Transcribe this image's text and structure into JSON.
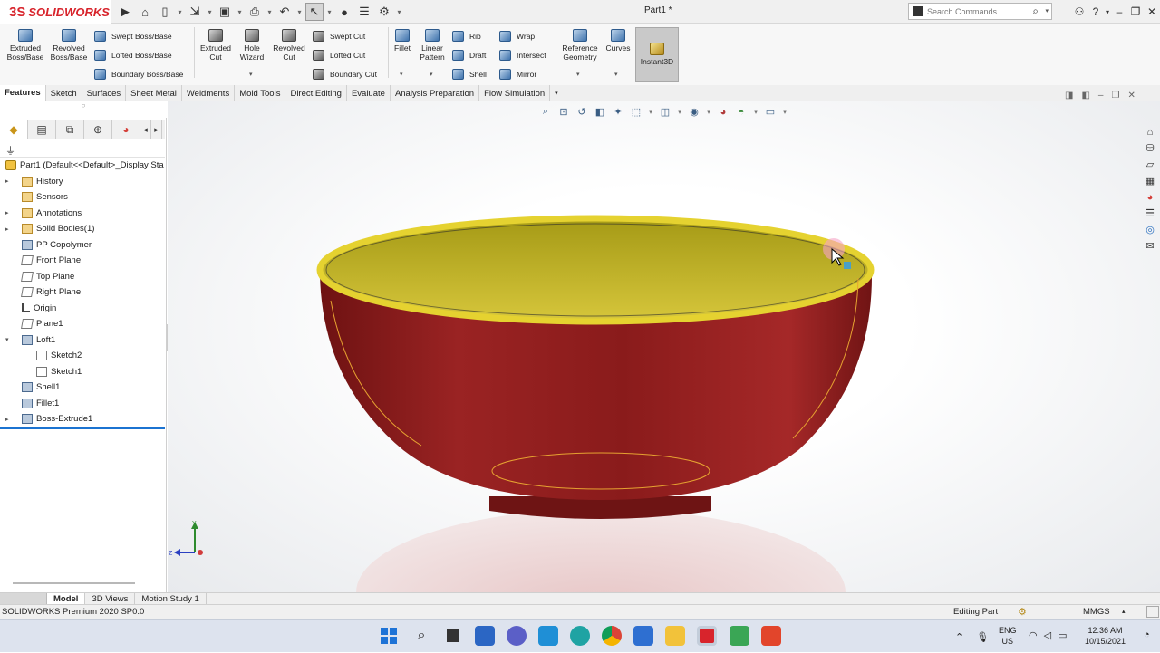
{
  "app": {
    "brand": "SOLIDWORKS",
    "brand_mark": "3S",
    "doc_title": "Part1 *"
  },
  "search": {
    "placeholder": "Search Commands"
  },
  "quick_access": [
    "home-icon",
    "new-document-icon",
    "open-icon",
    "save-icon",
    "print-icon",
    "undo-icon",
    "select-arrow-icon",
    "rebuild-icon",
    "file-properties-icon",
    "options-gear-icon"
  ],
  "ribbon": {
    "extruded_boss": "Extruded\nBoss/Base",
    "revolved_boss": "Revolved\nBoss/Base",
    "swept_boss": "Swept Boss/Base",
    "lofted_boss": "Lofted Boss/Base",
    "boundary_boss": "Boundary Boss/Base",
    "extruded_cut": "Extruded\nCut",
    "hole_wizard": "Hole\nWizard",
    "revolved_cut": "Revolved\nCut",
    "swept_cut": "Swept Cut",
    "lofted_cut": "Lofted Cut",
    "boundary_cut": "Boundary Cut",
    "fillet": "Fillet",
    "linear_pattern": "Linear\nPattern",
    "rib": "Rib",
    "draft": "Draft",
    "shell": "Shell",
    "wrap": "Wrap",
    "intersect": "Intersect",
    "mirror": "Mirror",
    "reference_geometry": "Reference\nGeometry",
    "curves": "Curves",
    "instant3d": "Instant3D"
  },
  "tabs": [
    "Features",
    "Sketch",
    "Surfaces",
    "Sheet Metal",
    "Weldments",
    "Mold Tools",
    "Direct Editing",
    "Evaluate",
    "Analysis Preparation",
    "Flow Simulation"
  ],
  "tree": {
    "root": "Part1  (Default<<Default>_Display Sta",
    "items": [
      {
        "label": "History",
        "expandable": true
      },
      {
        "label": "Sensors",
        "expandable": false
      },
      {
        "label": "Annotations",
        "expandable": true
      },
      {
        "label": "Solid Bodies(1)",
        "expandable": true
      },
      {
        "label": "PP Copolymer",
        "expandable": false
      },
      {
        "label": "Front Plane",
        "expandable": false
      },
      {
        "label": "Top Plane",
        "expandable": false
      },
      {
        "label": "Right Plane",
        "expandable": false
      },
      {
        "label": "Origin",
        "expandable": false
      },
      {
        "label": "Plane1",
        "expandable": false
      },
      {
        "label": "Loft1",
        "expandable": true
      },
      {
        "label": "Sketch2",
        "expandable": false
      },
      {
        "label": "Sketch1",
        "expandable": false
      },
      {
        "label": "Shell1",
        "expandable": false
      },
      {
        "label": "Fillet1",
        "expandable": false
      },
      {
        "label": "Boss-Extrude1",
        "expandable": true
      }
    ]
  },
  "model_colors": {
    "outer": "#8e1b1b",
    "inner": "#c7b51e",
    "rim": "#e5d230",
    "shadow": "#e8c6c6"
  },
  "triad": {
    "y": "Y",
    "z": "Z"
  },
  "bottom_tabs": [
    "Model",
    "3D Views",
    "Motion Study 1"
  ],
  "status": {
    "version": "SOLIDWORKS Premium 2020 SP0.0",
    "mode": "Editing Part",
    "units": "MMGS"
  },
  "taskbar": {
    "lang_top": "ENG",
    "lang_bottom": "US",
    "time": "12:36 AM",
    "date": "10/15/2021"
  }
}
